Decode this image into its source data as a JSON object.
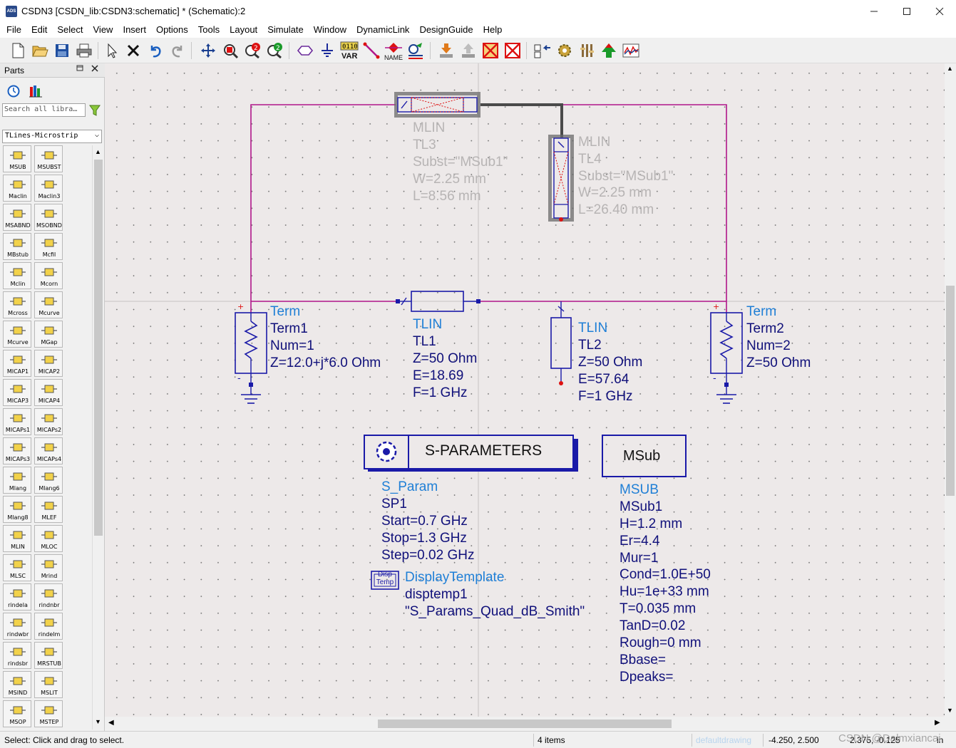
{
  "window": {
    "title": "CSDN3 [CSDN_lib:CSDN3:schematic] * (Schematic):2",
    "app_icon": "ADS"
  },
  "menu": [
    "File",
    "Edit",
    "Select",
    "View",
    "Insert",
    "Options",
    "Tools",
    "Layout",
    "Simulate",
    "Window",
    "DynamicLink",
    "DesignGuide",
    "Help"
  ],
  "toolbar": {
    "var_text": "VAR",
    "var_bits": "0110",
    "name_text": "NAME"
  },
  "parts": {
    "title": "Parts",
    "search_placeholder": "Search all libra…",
    "library": "TLines-Microstrip",
    "items": [
      "MSUB",
      "MSUBST",
      "Maclin",
      "Maclin3",
      "MSABND",
      "MSOBND",
      "MBstub",
      "Mcfil",
      "Mclin",
      "Mcorn",
      "Mcross",
      "Mcurve",
      "Mcurve",
      "MGap",
      "MICAP1",
      "MICAP2",
      "MICAP3",
      "MICAP4",
      "MICAPs1",
      "MICAPs2",
      "MICAPs3",
      "MICAPs4",
      "Mlang",
      "Mlang6",
      "Mlang8",
      "MLEF",
      "MLIN",
      "MLOC",
      "MLSC",
      "Mrind",
      "rindela",
      "rindnbr",
      "rindwbr",
      "rindelm",
      "rindsbr",
      "MRSTUB",
      "MSIND",
      "MSLIT",
      "MSOP",
      "MSTEP"
    ]
  },
  "schematic": {
    "tl3": {
      "type": "MLIN",
      "name": "TL3",
      "subst": "Subst=\"MSub1\"",
      "w": "W=2.25 mm",
      "l": "L=8.56 mm"
    },
    "tl4": {
      "type": "MLIN",
      "name": "TL4",
      "subst": "Subst=\"MSub1\"",
      "w": "W=2.25 mm",
      "l": "L=26.40 mm"
    },
    "term1": {
      "type": "Term",
      "name": "Term1",
      "num": "Num=1",
      "z": "Z=12.0+j*6.0 Ohm"
    },
    "tl1": {
      "type": "TLIN",
      "name": "TL1",
      "z": "Z=50 Ohm",
      "e": "E=18.69",
      "f": "F=1 GHz"
    },
    "tl2": {
      "type": "TLIN",
      "name": "TL2",
      "z": "Z=50 Ohm",
      "e": "E=57.64",
      "f": "F=1 GHz"
    },
    "term2": {
      "type": "Term",
      "name": "Term2",
      "num": "Num=2",
      "z": "Z=50 Ohm"
    },
    "sparam": {
      "box_title": "S-PARAMETERS",
      "type": "S_Param",
      "name": "SP1",
      "start": "Start=0.7 GHz",
      "stop": "Stop=1.3 GHz",
      "step": "Step=0.02 GHz"
    },
    "display": {
      "icon_line1": "Disp",
      "icon_line2": "Temp",
      "type": "DisplayTemplate",
      "name": "disptemp1",
      "value": "\"S_Params_Quad_dB_Smith\""
    },
    "msub": {
      "box_title": "MSub",
      "type": "MSUB",
      "name": "MSub1",
      "params": [
        "H=1.2 mm",
        "Er=4.4",
        "Mur=1",
        "Cond=1.0E+50",
        "Hu=1e+33 mm",
        "T=0.035 mm",
        "TanD=0.02",
        "Rough=0 mm",
        "Bbase=",
        "Dpeaks="
      ]
    }
  },
  "status": {
    "hint": "Select: Click and drag to select.",
    "items": "4 items",
    "layer": "defaultdrawing",
    "coord1": "-4.250, 2.500",
    "coord2": "2.375, -0.125",
    "unit": "in",
    "watermark": "CSDN @Dalmxiancai"
  },
  "colors": {
    "canvas_bg": "#ede9e9",
    "wire": "#b0168a",
    "component": "#1a1aa8",
    "component_label": "#1f7fd6",
    "param_text": "#10107a",
    "selection": "#555555"
  }
}
